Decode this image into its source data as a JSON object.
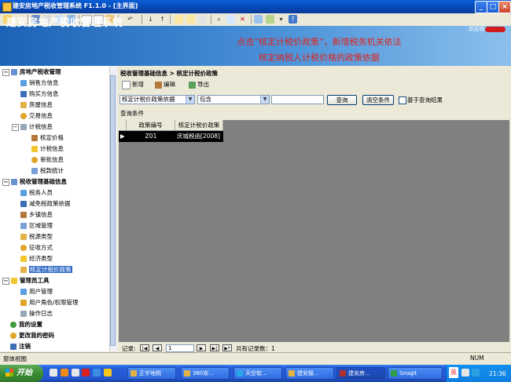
{
  "window": {
    "title": "建安房地产税收管理系统 F1.1.0 - [主界面]"
  },
  "banner": {
    "title": "建安房地产税收管理系统",
    "user_label": "欢迎你："
  },
  "about_link": "关于",
  "annotation": "点击“核定计税价政策”，新增税务机关依法核定纳税人计税价格的政策依据",
  "sidebar": {
    "groups": [
      {
        "label": "房地产税收管理",
        "expanded": true,
        "items": [
          {
            "label": "销售方信息"
          },
          {
            "label": "购买方信息"
          },
          {
            "label": "房屋信息"
          },
          {
            "label": "交易信息"
          },
          {
            "label": "计税信息",
            "expanded": true,
            "children": [
              {
                "label": "核定价格"
              },
              {
                "label": "计税信息"
              },
              {
                "label": "审批信息"
              },
              {
                "label": "税款统计"
              }
            ]
          }
        ]
      },
      {
        "label": "税收管理基础信息",
        "expanded": true,
        "items": [
          {
            "label": "税务人员"
          },
          {
            "label": "减免税政策依据"
          },
          {
            "label": "乡镇信息"
          },
          {
            "label": "区域管理"
          },
          {
            "label": "税源类型"
          },
          {
            "label": "征收方式"
          },
          {
            "label": "经济类型"
          },
          {
            "label": "核定计税价政策",
            "selected": true
          }
        ]
      },
      {
        "label": "管理员工具",
        "expanded": true,
        "items": [
          {
            "label": "用户管理"
          },
          {
            "label": "用户角色/权限管理"
          },
          {
            "label": "操作日志"
          }
        ]
      },
      {
        "label": "我的设置"
      },
      {
        "label": "更改我的密码"
      },
      {
        "label": "注销"
      }
    ]
  },
  "main": {
    "breadcrumb": "税收管理基础信息 > 核定计税价政策",
    "actions": {
      "add": "新增",
      "edit": "编辑",
      "export": "导出"
    },
    "filter": {
      "field": "核定计税价政策依据",
      "operator": "包含",
      "value": "",
      "search_button": "查询",
      "clear_button": "清空条件",
      "checkbox_label": "基于查询结果"
    },
    "conditions_label": "查询条件",
    "grid": {
      "columns": [
        "政策编号",
        "核定计税价政策"
      ],
      "rows": [
        [
          "Z01",
          "庆城税函[2008]"
        ]
      ]
    },
    "navigator": {
      "label": "记录:",
      "current": "1",
      "total_text": "共有记录数：1"
    }
  },
  "statusbar": {
    "left": "窗体视图",
    "right": "NUM"
  },
  "taskbar": {
    "start": "开始",
    "tasks": [
      "正宇地税",
      "360安...",
      "天空软...",
      "建安报...",
      "建安房...",
      "Snagit"
    ],
    "tray_lang": "英",
    "clock": "21:36"
  },
  "colors": {
    "accent": "#316ac5",
    "banner": "#1c63b7",
    "annotation": "#e0231b",
    "grid_bg": "#808080"
  }
}
